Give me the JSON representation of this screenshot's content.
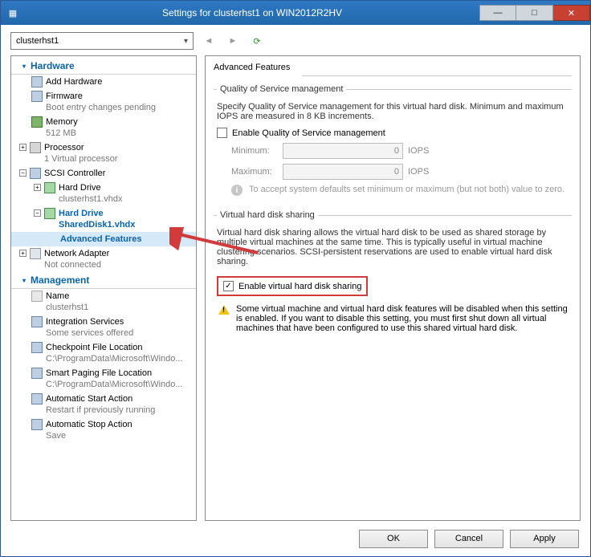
{
  "window": {
    "title": "Settings for clusterhst1 on WIN2012R2HV"
  },
  "toolbar": {
    "vm_selector": "clusterhst1"
  },
  "tree": {
    "hardware_header": "Hardware",
    "management_header": "Management",
    "items": {
      "add_hw": "Add Hardware",
      "firmware": "Firmware",
      "firmware_sub": "Boot entry changes pending",
      "memory": "Memory",
      "memory_sub": "512 MB",
      "processor": "Processor",
      "processor_sub": "1 Virtual processor",
      "scsi": "SCSI Controller",
      "hd1": "Hard Drive",
      "hd1_sub": "clusterhst1.vhdx",
      "hd2": "Hard Drive",
      "hd2_sub": "SharedDisk1.vhdx",
      "adv_feat": "Advanced Features",
      "net": "Network Adapter",
      "net_sub": "Not connected",
      "name": "Name",
      "name_sub": "clusterhst1",
      "integ": "Integration Services",
      "integ_sub": "Some services offered",
      "chkpt": "Checkpoint File Location",
      "chkpt_sub": "C:\\ProgramData\\Microsoft\\Windo...",
      "smart": "Smart Paging File Location",
      "smart_sub": "C:\\ProgramData\\Microsoft\\Windo...",
      "autostart": "Automatic Start Action",
      "autostart_sub": "Restart if previously running",
      "autostop": "Automatic Stop Action",
      "autostop_sub": "Save"
    }
  },
  "panel": {
    "heading": "Advanced Features",
    "qos": {
      "legend": "Quality of Service management",
      "desc": "Specify Quality of Service management for this virtual hard disk. Minimum and maximum IOPS are measured in 8 KB increments.",
      "enable_label": "Enable Quality of Service management",
      "min_label": "Minimum:",
      "max_label": "Maximum:",
      "min_value": "0",
      "max_value": "0",
      "unit": "IOPS",
      "info": "To accept system defaults set minimum or maximum (but not both) value to zero."
    },
    "sharing": {
      "legend": "Virtual hard disk sharing",
      "desc": "Virtual hard disk sharing allows the virtual hard disk to be used as shared storage by multiple virtual machines at the same time. This is typically useful in virtual machine clustering scenarios. SCSI-persistent reservations are used to enable virtual hard disk sharing.",
      "enable_label": "Enable virtual hard disk sharing",
      "warn": "Some virtual machine and virtual hard disk features will be disabled when this setting is enabled. If you want to disable this setting, you must first shut down all virtual machines that have been configured to use this shared virtual hard disk."
    }
  },
  "buttons": {
    "ok": "OK",
    "cancel": "Cancel",
    "apply": "Apply"
  }
}
